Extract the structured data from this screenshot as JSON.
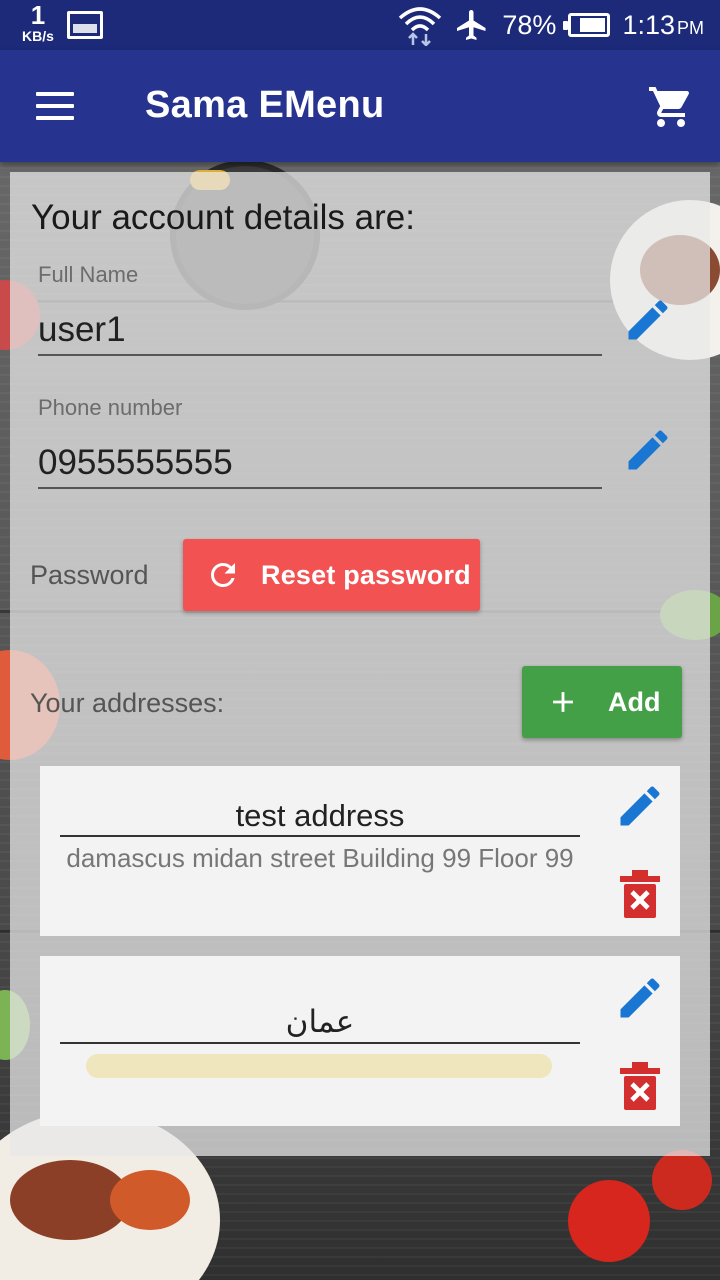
{
  "status_bar": {
    "speed_value": "1",
    "speed_unit": "KB/s",
    "battery": "78%",
    "time": "1:13",
    "ampm": "PM",
    "battery_level": 0.78
  },
  "app_bar": {
    "title": "Sama EMenu",
    "color": "#26338f"
  },
  "account": {
    "heading": "Your account details are:",
    "full_name_label": "Full Name",
    "full_name_value": "user1",
    "phone_label": "Phone number",
    "phone_value": "0955555555",
    "password_label": "Password",
    "reset_button_label": "Reset password",
    "reset_color": "#f25252"
  },
  "addresses": {
    "label": "Your addresses:",
    "add_button_label": "Add",
    "add_color": "#43a047",
    "items": [
      {
        "title": "test address",
        "detail": "damascus midan street Building 99 Floor 99"
      },
      {
        "title": "عمان",
        "detail": ""
      }
    ]
  },
  "colors": {
    "edit_icon": "#1976d2",
    "delete_icon": "#d32f2f"
  }
}
